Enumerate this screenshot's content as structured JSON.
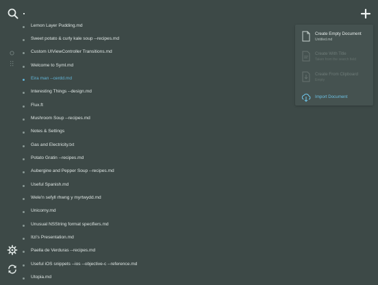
{
  "colors": {
    "background": "#3d4947",
    "menu_background": "#455250",
    "accent": "#62b5d8",
    "text": "#dfe6e4"
  },
  "toolbar": {
    "search_icon": "search-icon",
    "add_icon": "plus-icon"
  },
  "sidebar": {
    "icons": [
      "circle-icon",
      "grip-icon",
      "gear-icon",
      "sync-icon"
    ]
  },
  "files": [
    {
      "name": "Lemon Layer Pudding.md",
      "active": false
    },
    {
      "name": "Sweet potato & curly kale soup --recipes.md",
      "active": false
    },
    {
      "name": "Custom UIViewController Transitions.md",
      "active": false
    },
    {
      "name": "Welcome to Syml.md",
      "active": false
    },
    {
      "name": "Eira man --cerdd.md",
      "active": true
    },
    {
      "name": "Interesting Things --design.md",
      "active": false
    },
    {
      "name": "Flux.ft",
      "active": false
    },
    {
      "name": "Mushroom Soup --recipes.md",
      "active": false
    },
    {
      "name": "Notes & Settings",
      "active": false
    },
    {
      "name": "Gas and Electricity.txt",
      "active": false
    },
    {
      "name": "Potato Gratin --recipes.md",
      "active": false
    },
    {
      "name": "Aubergine and Pepper Soup --recipes.md",
      "active": false
    },
    {
      "name": "Useful Spanish.md",
      "active": false
    },
    {
      "name": "Wele'n sefyll rhwng y myrtwydd.md",
      "active": false
    },
    {
      "name": "Unicorny.md",
      "active": false
    },
    {
      "name": "Unusual NSString format specifiers.md",
      "active": false
    },
    {
      "name": "Itzi's Presentation.md",
      "active": false
    },
    {
      "name": "Paella de Verduras --recipes.md",
      "active": false
    },
    {
      "name": "Useful iOS snippets --ios --objective-c --reference.md",
      "active": false
    },
    {
      "name": "Utopia.md",
      "active": false
    }
  ],
  "new_menu": {
    "items": [
      {
        "title": "Create Empty Document",
        "subtitle": "Untitled.md",
        "enabled": true,
        "icon": "document-icon"
      },
      {
        "title": "Create With Title",
        "subtitle": "Taken from the search field",
        "enabled": false,
        "icon": "document-title-icon"
      },
      {
        "title": "Create From Clipboard",
        "subtitle": "Empty",
        "enabled": false,
        "icon": "clipboard-icon"
      },
      {
        "title": "Import Document",
        "subtitle": "",
        "enabled": true,
        "icon": "cloud-download-icon"
      }
    ]
  }
}
